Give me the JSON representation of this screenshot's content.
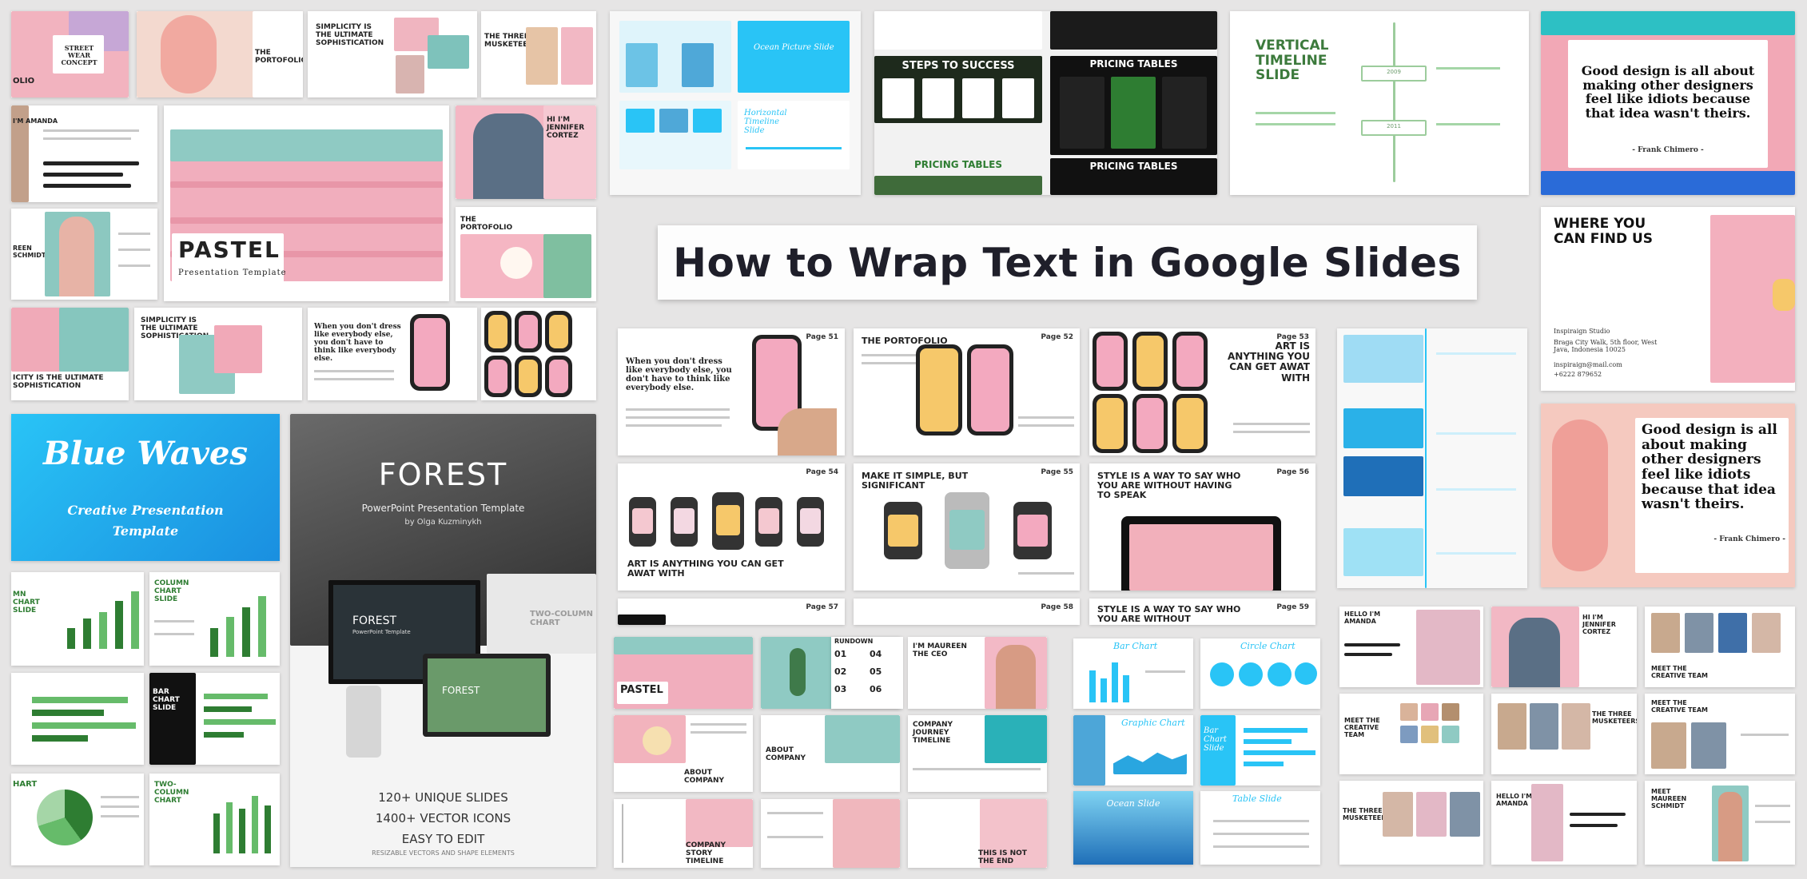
{
  "headline": "How to Wrap Text in Google Slides",
  "colors": {
    "background": "#e6e5e5",
    "pastel_pink": "#f2a7b6",
    "teal": "#8ccbc4",
    "forest_green": "#2e7d32",
    "sky_blue": "#29b6f6"
  },
  "thumbs": {
    "street_wear": "STREET WEAR CONCEPT",
    "folio": "OLIO",
    "portofolio": "THE PORTOFOLIO",
    "simplicity": "SIMPLICITY IS THE ULTIMATE SOPHISTICATION",
    "three_musketeers": "THE THREE MUSKETEERS",
    "hi_jennifer": "HI I'M JENNIFER CORTEZ",
    "pastel_title": "PASTEL",
    "pastel_sub": "Presentation Template",
    "reen_schmidt": "REEN SCHMIDT",
    "icity": "ICITY IS THE ULTIMATE SOPHISTICATION",
    "simplicity2": "SIMPLICITY IS THE ULTIMATE SOPHISTICATION",
    "dress_quote": "When you don't dress like everybody else, you don't have to think like everybody else.",
    "blue_waves_title": "Blue Waves",
    "blue_waves_sub": "Creative Presentation Template",
    "forest_title": "FOREST",
    "forest_sub": "PowerPoint Presentation Template",
    "forest_author": "by Olga Kuzminykh",
    "forest_screen": "FOREST",
    "forest_screen_sub": "PowerPoint Template",
    "forest_monitor": "FOREST",
    "two_column": "TWO-COLUMN CHART",
    "unique_slides": "120+ UNIQUE SLIDES",
    "vector_icons": "1400+ VECTOR ICONS",
    "easy_edit": "EASY TO EDIT",
    "resizable": "RESIZABLE VECTORS AND SHAPE ELEMENTS",
    "column_chart": "COLUMN CHART SLIDE",
    "mn_chart": "MN CHART SLIDE",
    "bar_chart": "BAR CHART SLIDE",
    "hart": "HART",
    "two_column_chart": "TWO-COLUMN CHART",
    "ocean_slide": "Ocean Picture Slide",
    "horizontal_timeline": "Horizontal Timeline Slide",
    "steps_success": "STEPS TO SUCCESS",
    "pricing_tables": "PRICING TABLES",
    "pricing_tables2": "PRICING TABLES",
    "pricing_tables3": "PRICING TABLES",
    "vertical_timeline": "VERTICAL TIMELINE SLIDE",
    "design_quote": "Good design is all about making other designers feel like idiots because that idea wasn't theirs.",
    "design_author": "- Frank Chimero -",
    "where_find": "WHERE YOU CAN FIND US",
    "studio": "Inspiraign Studio",
    "address": "Braga City Walk, 5th floor, West Java, Indonesia 10025",
    "email": "inspiraign@mail.com",
    "phone": "+6222 879652",
    "design_quote2": "Good design is all about making other designers feel like idiots because that idea wasn't theirs.",
    "design_author2": "- Frank Chimero -",
    "page51": "Page 51",
    "page52": "Page 52",
    "page53": "Page 53",
    "page54": "Page 54",
    "page55": "Page 55",
    "page56": "Page 56",
    "page57": "Page 57",
    "page58": "Page 58",
    "page59": "Page 59",
    "dress_quote2": "When you don't dress like everybody else, you don't have to think like everybody else.",
    "portofolio2": "THE PORTOFOLIO",
    "art_anything": "ART IS ANYTHING YOU CAN GET AWAT WITH",
    "art_anything2": "ART IS ANYTHING YOU CAN GET AWAT WITH",
    "make_simple": "MAKE IT SIMPLE, BUT SIGNIFICANT",
    "style_way": "STYLE IS A WAY TO SAY WHO YOU ARE WITHOUT HAVING TO SPEAK",
    "style_way2": "STYLE IS A WAY TO SAY WHO YOU ARE WITHOUT",
    "rundown": "RUNDOWN",
    "maureen_ceo": "I'M MAUREEN THE CEO",
    "pastel_small": "PASTEL",
    "about_company": "ABOUT COMPANY",
    "about_company2": "ABOUT COMPANY",
    "company_journey": "COMPANY JOURNEY TIMELINE",
    "company_story": "COMPANY STORY TIMELINE",
    "not_end": "THIS IS NOT THE END",
    "bar_chart_script": "Bar Chart",
    "circle_chart": "Circle Chart",
    "graphic_chart": "Graphic Chart",
    "bar_chart_slide": "Bar Chart Slide",
    "ocean_slide2": "Ocean Slide",
    "table_slide": "Table Slide",
    "hello_amanda": "HELLO I'M AMANDA",
    "hi_jennifer2": "HI I'M JENNIFER CORTEZ",
    "meet_team": "MEET THE CREATIVE TEAM",
    "meet_team2": "MEET THE CREATIVE TEAM",
    "three_musk2": "THE THREE MUSKETEERS",
    "meet_team3": "MEET THE CREATIVE TEAM",
    "three_musk3": "THE THREE MUSKETEERS",
    "hello_amanda2": "HELLO I'M AMANDA",
    "meet_maureen": "MEET MAUREEN SCHMIDT",
    "amanda_left": "I'M AMANDA",
    "num01": "01",
    "num02": "02",
    "num03": "03",
    "num04": "04",
    "num05": "05",
    "num06": "06",
    "year2009": "2009",
    "year2011": "2011"
  }
}
